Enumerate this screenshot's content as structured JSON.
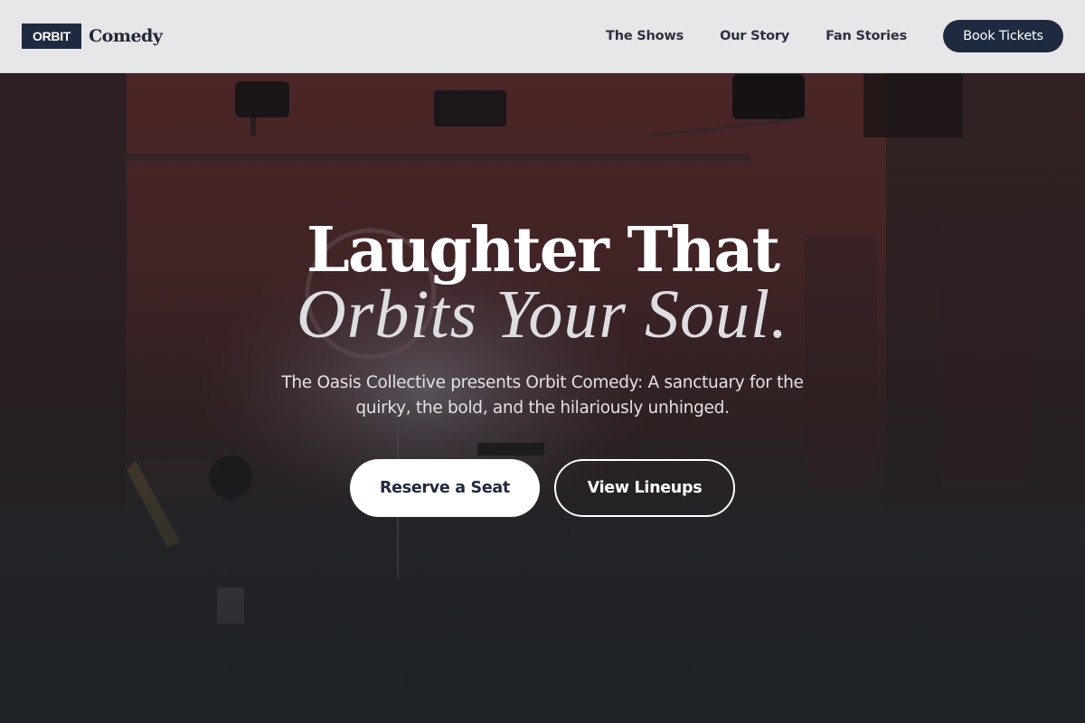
{
  "brand": {
    "badge": "ORBIT",
    "name": "Comedy"
  },
  "nav": {
    "items": [
      {
        "label": "The Shows"
      },
      {
        "label": "Our Story"
      },
      {
        "label": "Fan Stories"
      }
    ],
    "cta_label": "Book Tickets"
  },
  "hero": {
    "headline_line1": "Laughter That",
    "headline_line2": "Orbits Your Soul.",
    "subtitle": "The Oasis Collective presents Orbit Comedy: A sanctuary for the quirky, the bold, and the hilariously unhinged.",
    "primary_cta": "Reserve a Seat",
    "secondary_cta": "View Lineups"
  },
  "colors": {
    "navy": "#1e2a40",
    "nav_bg": "#ececee",
    "hero_red": "#5a2a2b",
    "hero_dark": "#232629",
    "white": "#ffffff"
  }
}
